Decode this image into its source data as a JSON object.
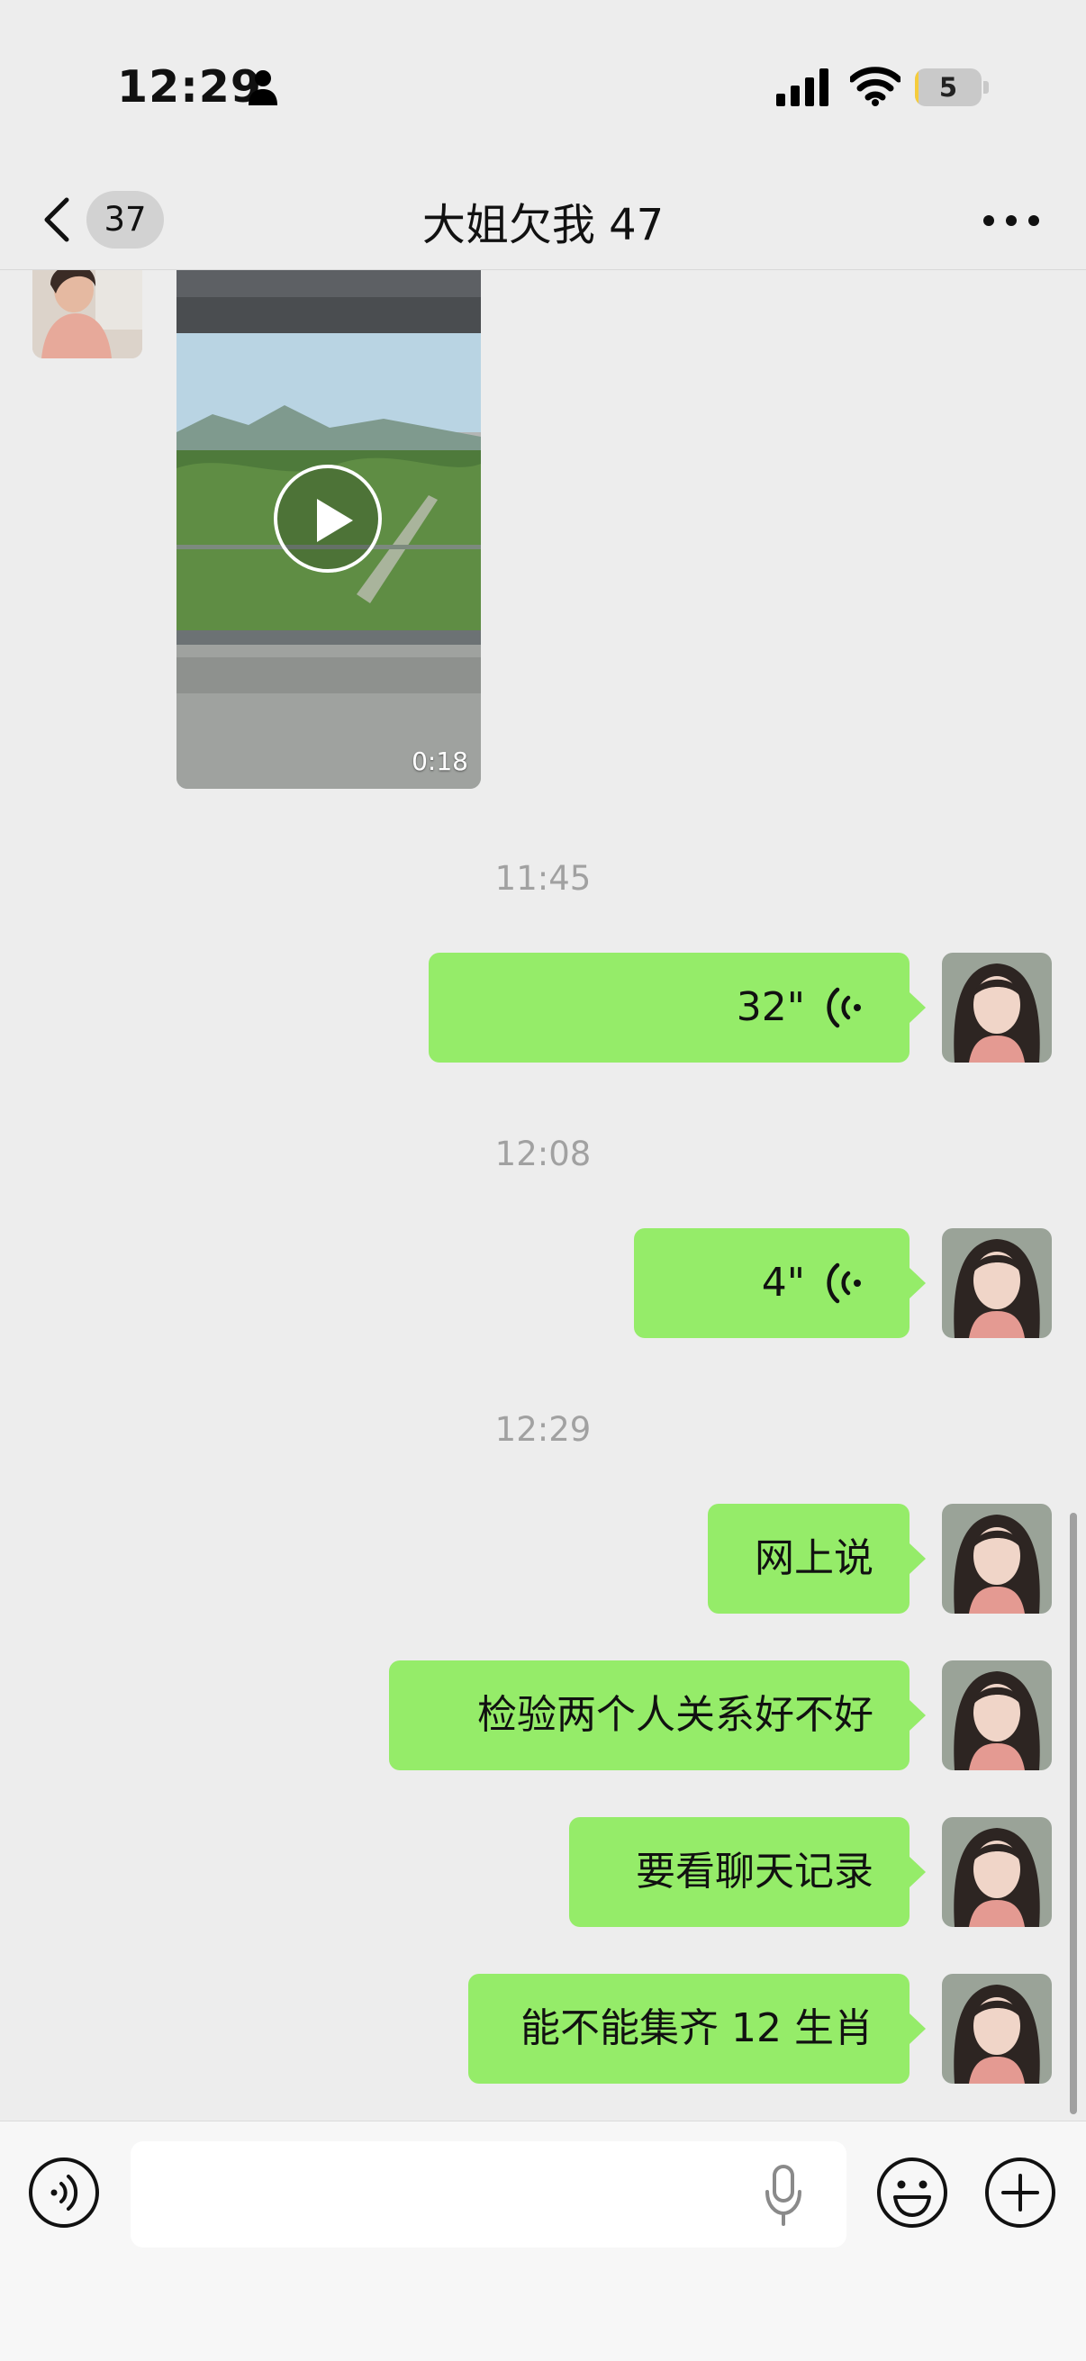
{
  "status_bar": {
    "time": "12:29",
    "battery_level": "5",
    "battery_fraction": 0.05,
    "icons": [
      "person-icon",
      "cellular-signal-icon",
      "wifi-icon",
      "battery-icon"
    ]
  },
  "nav": {
    "unread_count": "37",
    "title": "大姐欠我 47",
    "icons": [
      "chevron-left-icon",
      "more-icon"
    ]
  },
  "messages": {
    "video": {
      "duration": "0:18",
      "icon": "play-icon"
    },
    "time_1": "11:45",
    "voice_1": "32\"",
    "time_2": "12:08",
    "voice_2": "4\"",
    "time_3": "12:29",
    "text_1": "网上说",
    "text_2": "检验两个人关系好不好",
    "text_3": "要看聊天记录",
    "text_4": "能不能集齐 12 生肖"
  },
  "input_bar": {
    "value": "",
    "icons": [
      "voice-toggle-icon",
      "microphone-icon",
      "emoji-icon",
      "plus-icon"
    ]
  },
  "colors": {
    "background": "#ededed",
    "sent_bubble": "#95ec69",
    "timestamp": "#a1a1a1",
    "input_bar": "#f7f7f7"
  }
}
